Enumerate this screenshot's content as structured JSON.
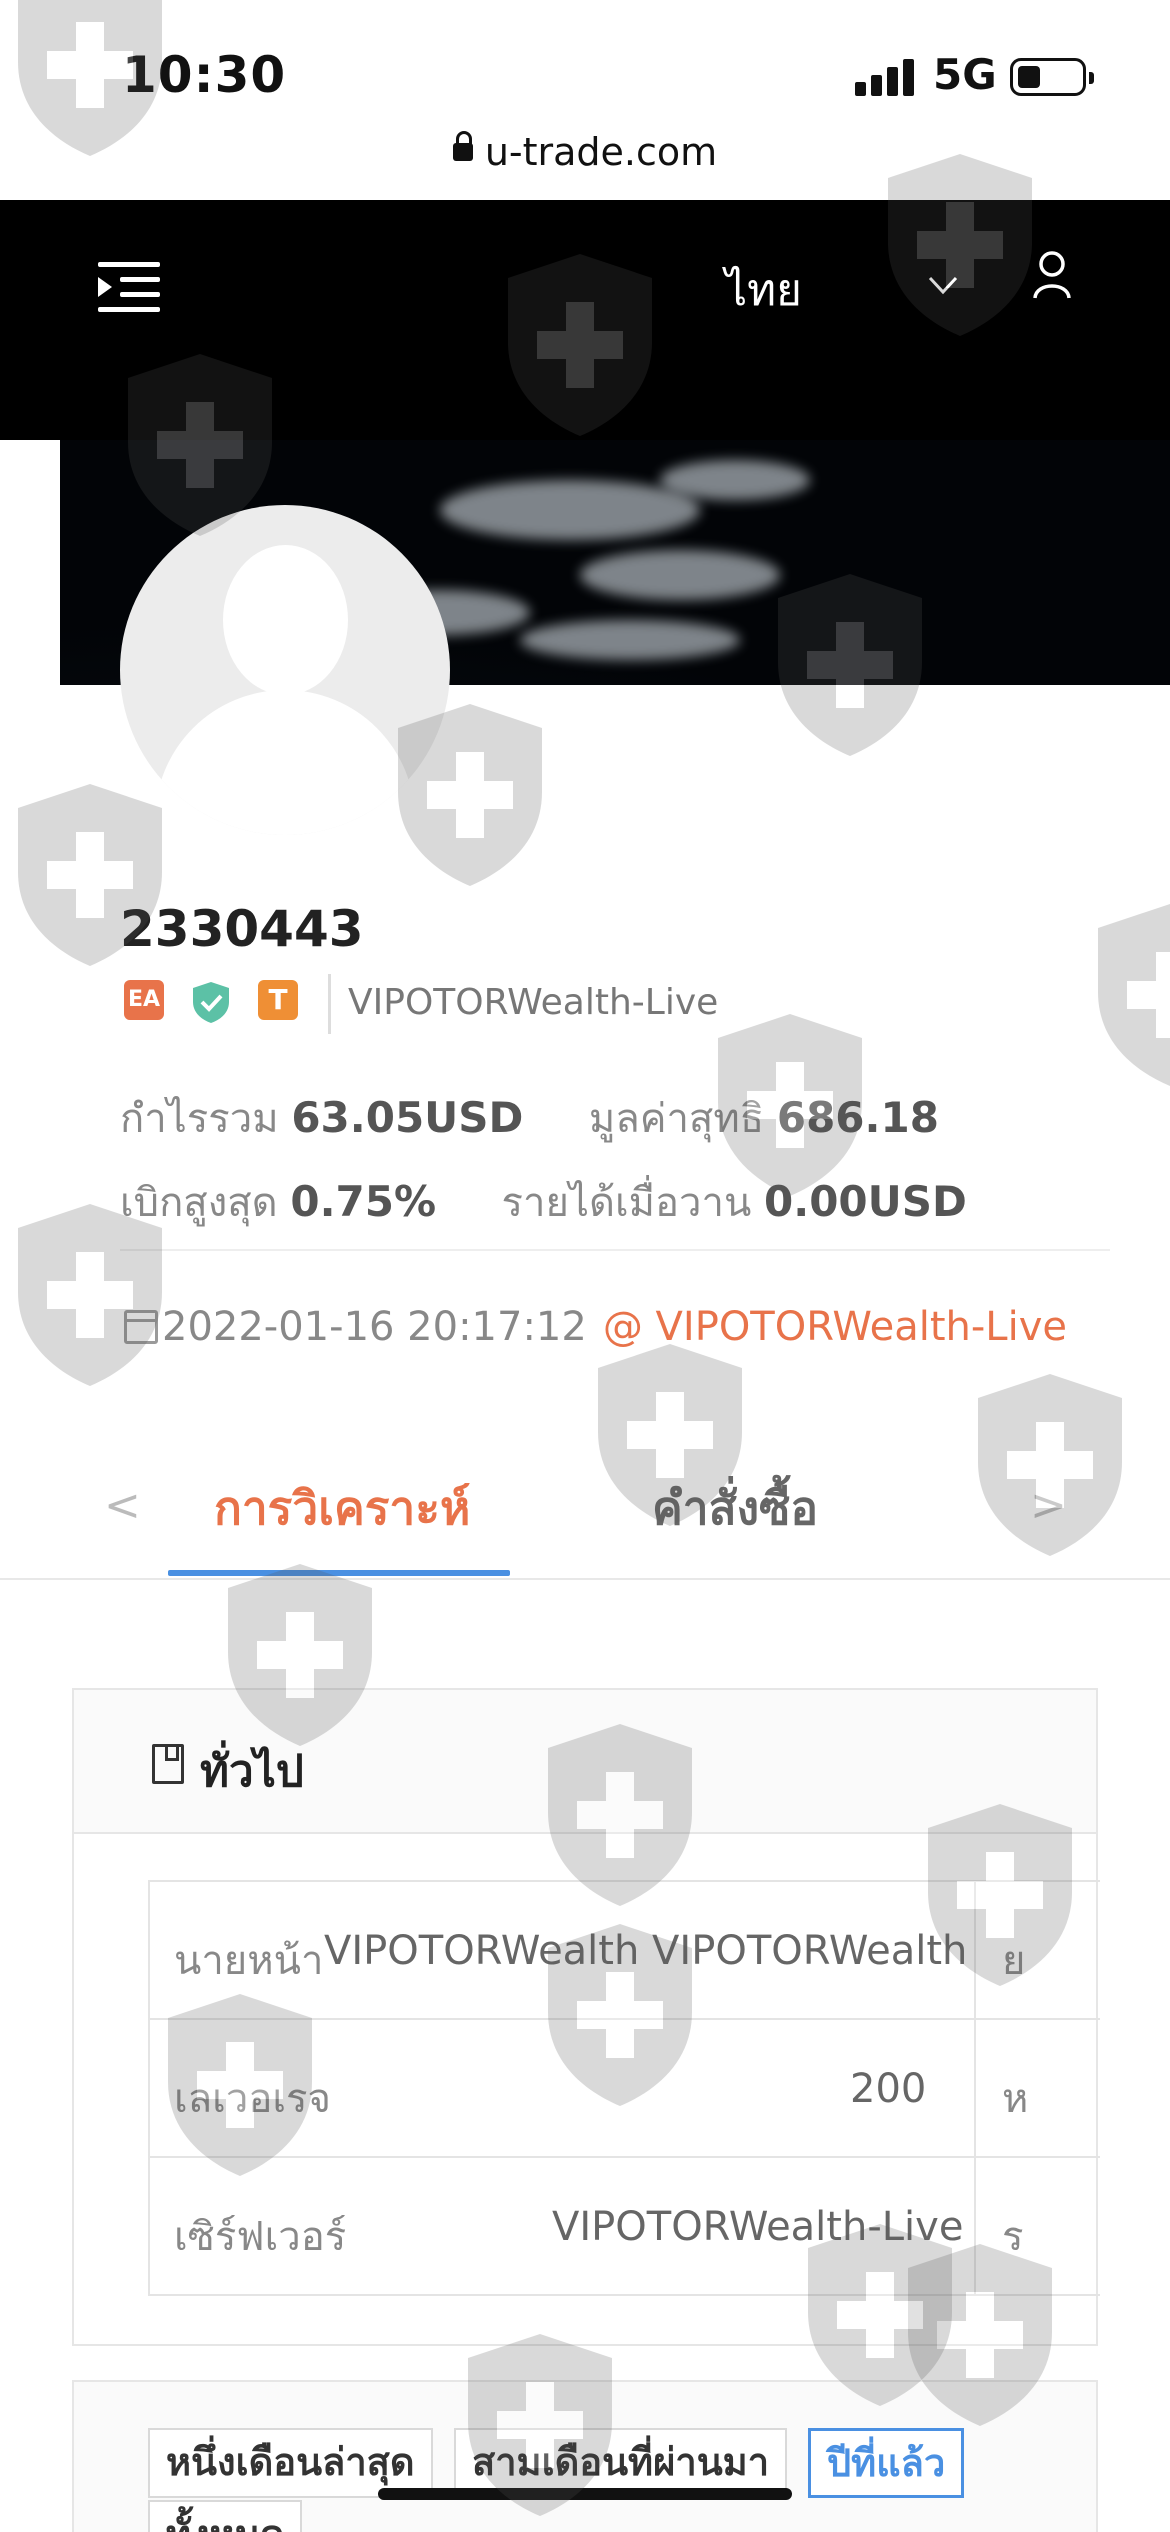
{
  "status_bar": {
    "time": "10:30",
    "network": "5G",
    "url": "u-trade.com"
  },
  "header": {
    "language": "ไทย",
    "icons": [
      "menu-icon",
      "chevron-down-icon",
      "user-icon"
    ]
  },
  "profile": {
    "account_id": "2330443",
    "badges": [
      {
        "label": "EA",
        "color": "#e8734a"
      },
      {
        "label": "",
        "icon": "verified-shield-icon",
        "color": "#5cc1a6"
      },
      {
        "label": "T",
        "color": "#ef8f35"
      }
    ],
    "server": "VIPOTORWealth-Live",
    "stats": {
      "total_profit_label": "กำไรรวม",
      "total_profit_value": "63.05USD",
      "net_value_label": "มูลค่าสุทธิ",
      "net_value_value": "686.18",
      "max_drawdown_label": "เบิกสูงสุด",
      "max_drawdown_value": "0.75%",
      "yesterday_income_label": "รายได้เมื่อวาน",
      "yesterday_income_value": "0.00USD"
    },
    "created": "2022-01-16 20:17:12",
    "created_link": "@ VIPOTORWealth-Live"
  },
  "tabs": {
    "prev": "<",
    "next": ">",
    "items": [
      {
        "label": "การวิเคราะห์",
        "active": true
      },
      {
        "label": "คำสั่งซื้อ",
        "active": false
      }
    ]
  },
  "general": {
    "title": "ทั่วไป",
    "rows": [
      {
        "label": "นายหน้า",
        "value": "VIPOTORWealth VIPOTORWealth",
        "cut": "ย"
      },
      {
        "label": "เลเวอเรจ",
        "value": "200",
        "cut": "ห"
      },
      {
        "label": "เซิร์ฟเวอร์",
        "value": "VIPOTORWealth-Live",
        "cut": "ร"
      }
    ]
  },
  "periods": {
    "options": [
      "หนึ่งเดือนล่าสุด",
      "สามเดือนที่ผ่านมา",
      "ปีที่แล้ว",
      "ทั้งหมด"
    ],
    "selected": "ปีที่แล้ว"
  },
  "colors": {
    "accent_orange": "#e8734a",
    "accent_blue": "#4a90e2",
    "header_bg": "#000000"
  }
}
